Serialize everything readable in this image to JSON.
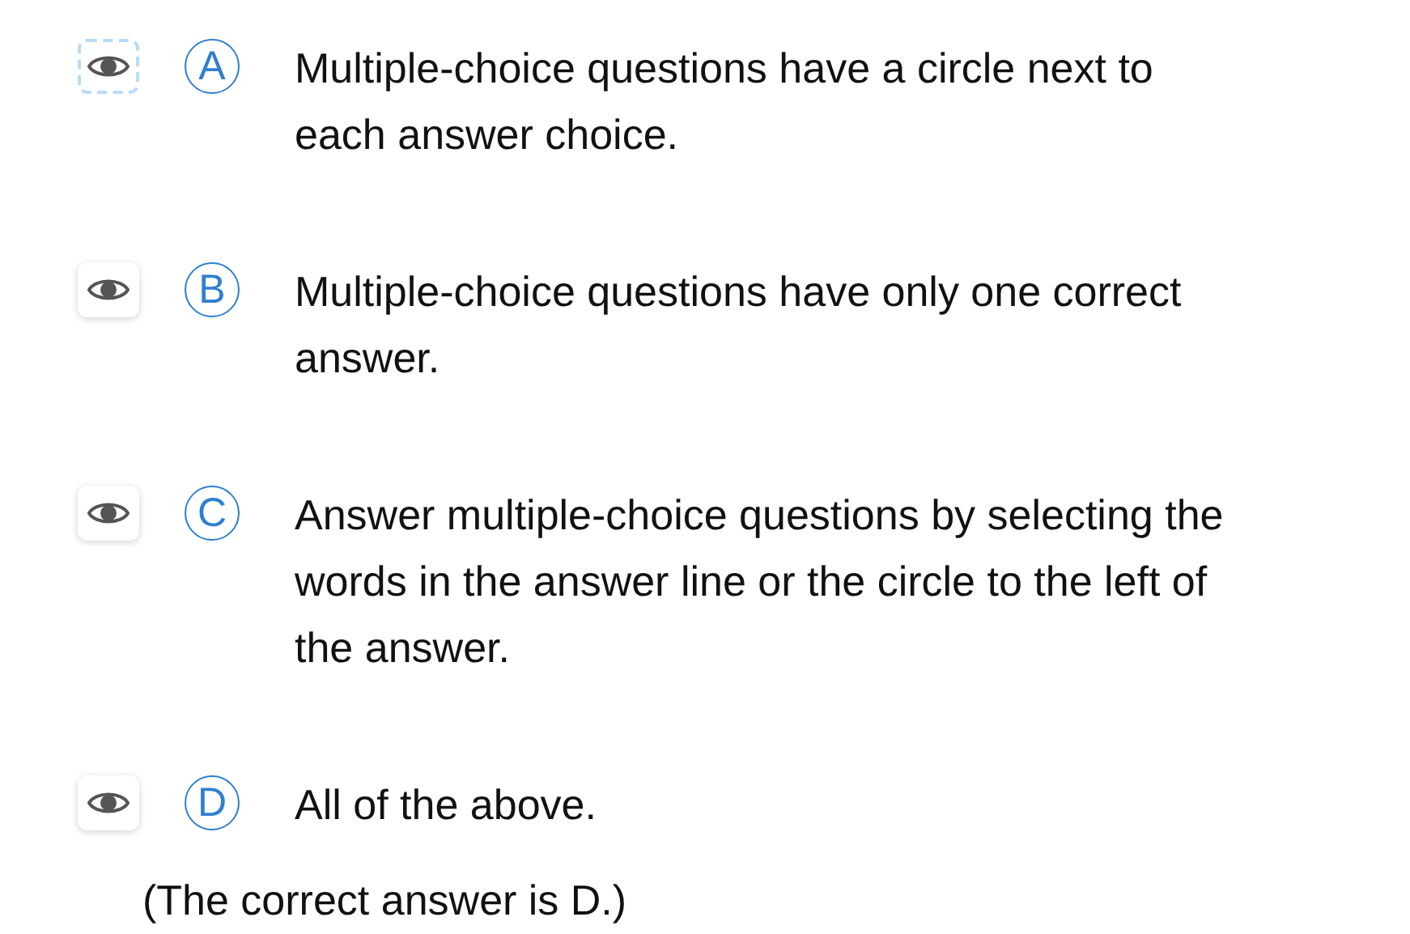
{
  "choices": [
    {
      "letter": "A",
      "text": "Multiple-choice questions have a circle next to each answer choice.",
      "focused": true
    },
    {
      "letter": "B",
      "text": "Multiple-choice questions have only one correct answer.",
      "focused": false
    },
    {
      "letter": "C",
      "text": "Answer multiple-choice questions by selecting the words in the answer line or the circle to the left of the answer.",
      "focused": false
    },
    {
      "letter": "D",
      "text": "All of the above.",
      "focused": false
    }
  ],
  "answer_note": "(The correct answer is D.)"
}
